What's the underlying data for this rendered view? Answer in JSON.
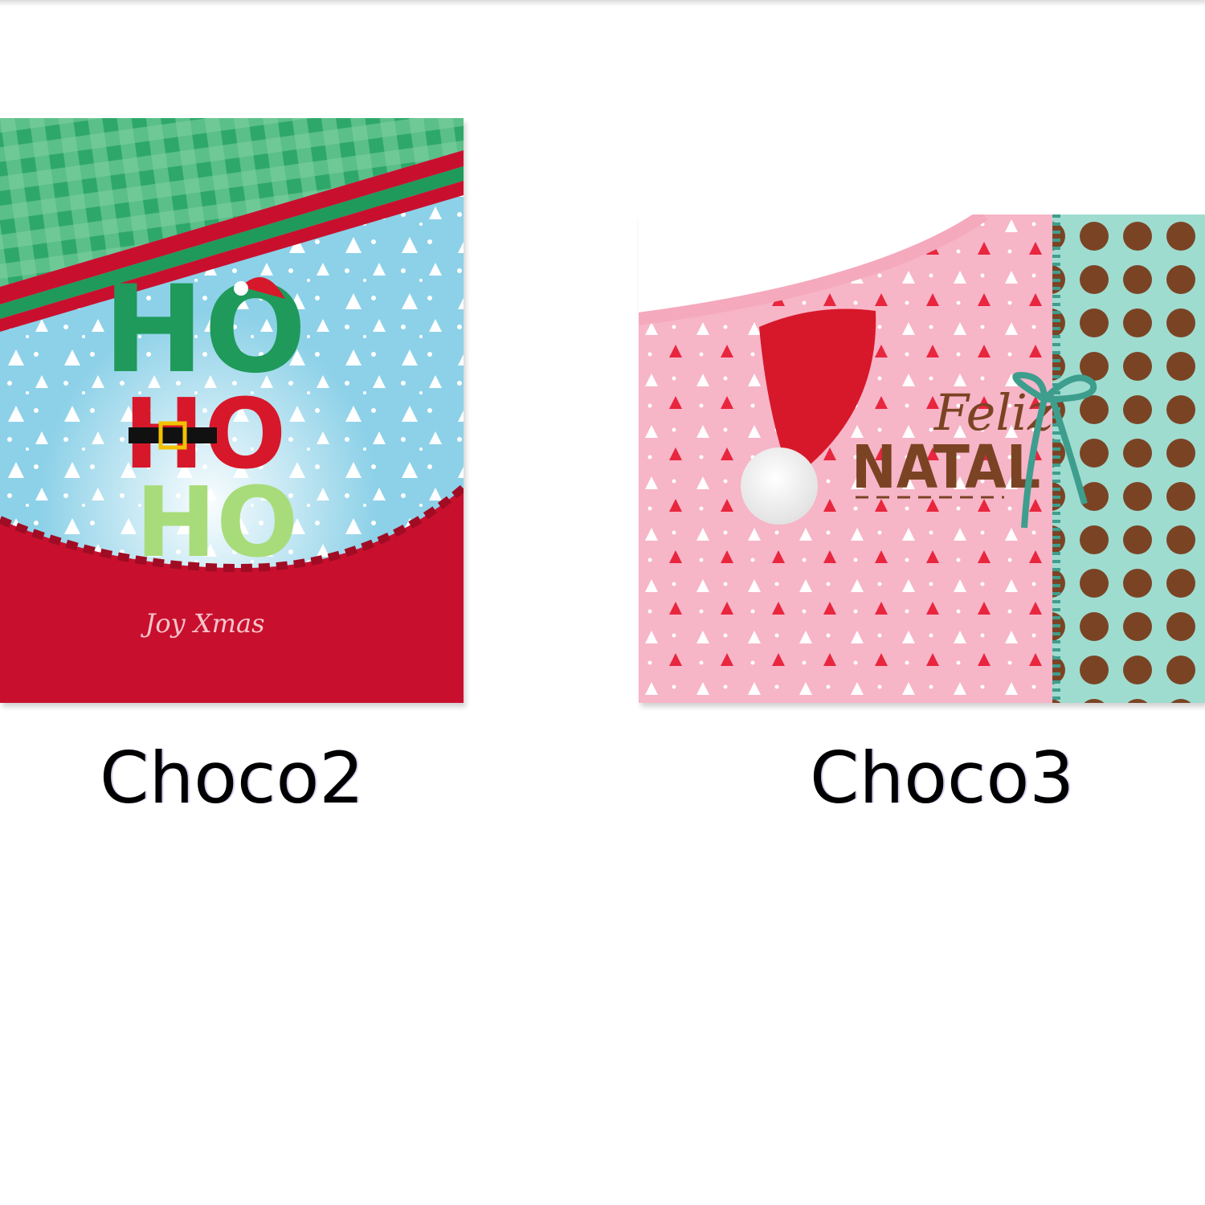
{
  "files": [
    {
      "name": "Choco2",
      "thumbnail": {
        "icon": "christmas-ho-ho-ho-image-icon",
        "text": [
          "HO",
          "HO",
          "HO"
        ],
        "colors": {
          "green_stripe": "#1f9a5a",
          "sky": "#8dd1e8",
          "red": "#c8102e",
          "light_green": "#a8dc7a"
        }
      }
    },
    {
      "name": "Choco3",
      "thumbnail": {
        "icon": "christmas-feliz-natal-image-icon",
        "text": [
          "NATAL"
        ],
        "colors": {
          "pink": "#f7b5c8",
          "hat_red": "#d7182a",
          "mint": "#9fdcd0",
          "brown_dots": "#7a4424"
        }
      }
    }
  ]
}
